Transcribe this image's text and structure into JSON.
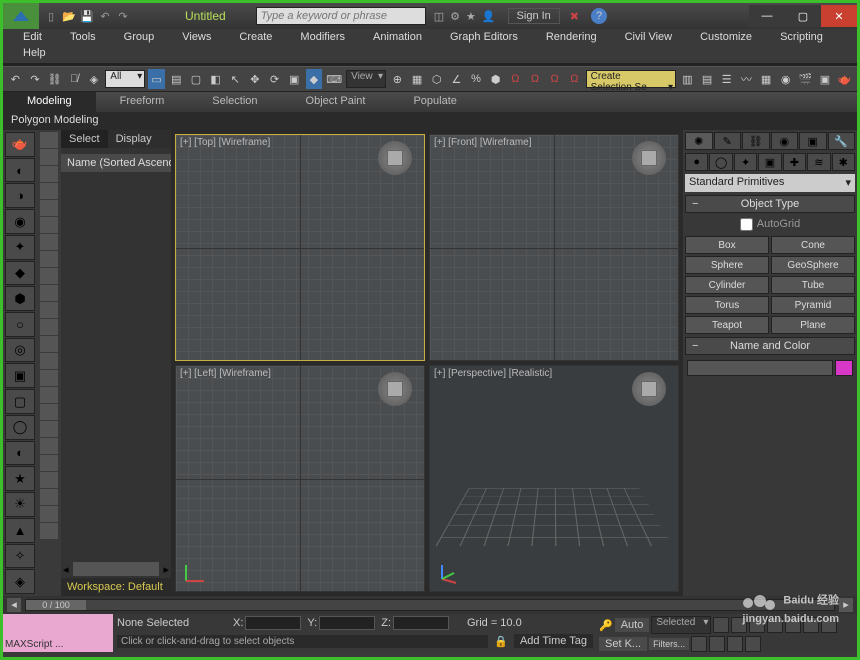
{
  "title": "Untitled",
  "search_placeholder": "Type a keyword or phrase",
  "signin": "Sign In",
  "menu": [
    "Edit",
    "Tools",
    "Group",
    "Views",
    "Create",
    "Modifiers",
    "Animation",
    "Graph Editors",
    "Rendering",
    "Civil View",
    "Customize",
    "Scripting"
  ],
  "menu_help": "Help",
  "toolbar": {
    "filter_all": "All",
    "layout_view": "View",
    "create_sel": "Create Selection Se"
  },
  "ribbon": {
    "tabs": [
      "Modeling",
      "Freeform",
      "Selection",
      "Object Paint",
      "Populate"
    ],
    "sub": "Polygon Modeling"
  },
  "scene": {
    "tabs": [
      "Select",
      "Display"
    ],
    "header": "Name (Sorted Ascend",
    "workspace": "Workspace: Default"
  },
  "viewports": {
    "top": "[+] [Top] [Wireframe]",
    "front": "[+] [Front] [Wireframe]",
    "left": "[+] [Left] [Wireframe]",
    "persp": "[+] [Perspective] [Realistic]"
  },
  "cmd": {
    "dropdown": "Standard Primitives",
    "objtype": "Object Type",
    "autogrid": "AutoGrid",
    "buttons": [
      "Box",
      "Cone",
      "Sphere",
      "GeoSphere",
      "Cylinder",
      "Tube",
      "Torus",
      "Pyramid",
      "Teapot",
      "Plane"
    ],
    "namecolor": "Name and Color"
  },
  "timeline": {
    "pos": "0 / 100"
  },
  "status": {
    "script": "MAXScript ...",
    "none": "None Selected",
    "x": "X:",
    "y": "Y:",
    "z": "Z:",
    "grid": "Grid = 10.0",
    "prompt": "Click or click-and-drag to select objects",
    "addtag": "Add Time Tag",
    "auto": "Auto",
    "setk": "Set K...",
    "selected": "Selected",
    "filters": "Filters..."
  },
  "watermark": {
    "main": "Baidu 经验",
    "sub": "jingyan.baidu.com"
  }
}
